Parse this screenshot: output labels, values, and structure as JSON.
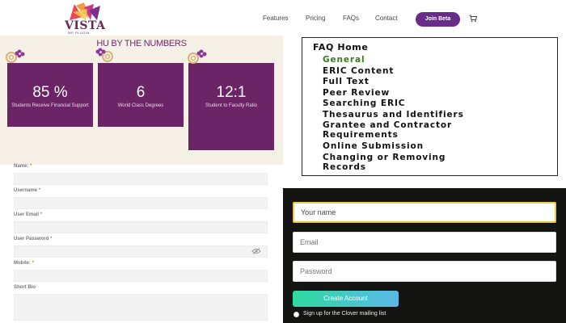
{
  "header": {
    "logo_text": "VISTA",
    "logo_sub": "WP PLUGIN",
    "nav": [
      "Features",
      "Pricing",
      "FAQs",
      "Contact"
    ],
    "join_label": "Join Beta",
    "cart_icon": "cart-icon"
  },
  "stats": {
    "title": "HU BY THE NUMBERS",
    "items": [
      {
        "value": "85 %",
        "label": "Students Receive Financial Support"
      },
      {
        "value": "6",
        "label": "World Class Degrees"
      },
      {
        "value": "12:1",
        "label": "Student to Faculty Ratio"
      }
    ],
    "colors": {
      "card": "#6b2466",
      "background": "#f5f1e6"
    }
  },
  "form": {
    "fields": [
      {
        "label": "Name:",
        "required": "*"
      },
      {
        "label": "Username",
        "required": "*"
      },
      {
        "label": "User Email",
        "required": "*"
      },
      {
        "label": "User Password",
        "required": "*"
      },
      {
        "label": "Mobile:",
        "required": "*"
      },
      {
        "label": "Short Bio",
        "required": ""
      }
    ],
    "password_toggle_icon": "eye-slash-icon"
  },
  "faq": {
    "title": "FAQ Home",
    "items": [
      "General",
      "ERIC Content",
      "Full Text",
      "Peer Review",
      "Searching ERIC",
      "Thesaurus and Identifiers",
      "Grantee and Contractor",
      "Requirements",
      "Online Submission",
      "Changing or Removing",
      "Records"
    ],
    "active_color": "#3a7a23"
  },
  "signup": {
    "name_placeholder": "Your name",
    "email_placeholder": "Email",
    "password_placeholder": "Password",
    "button_label": "Create Account",
    "checkbox_label": "Sign up for the Clover mailing list"
  }
}
